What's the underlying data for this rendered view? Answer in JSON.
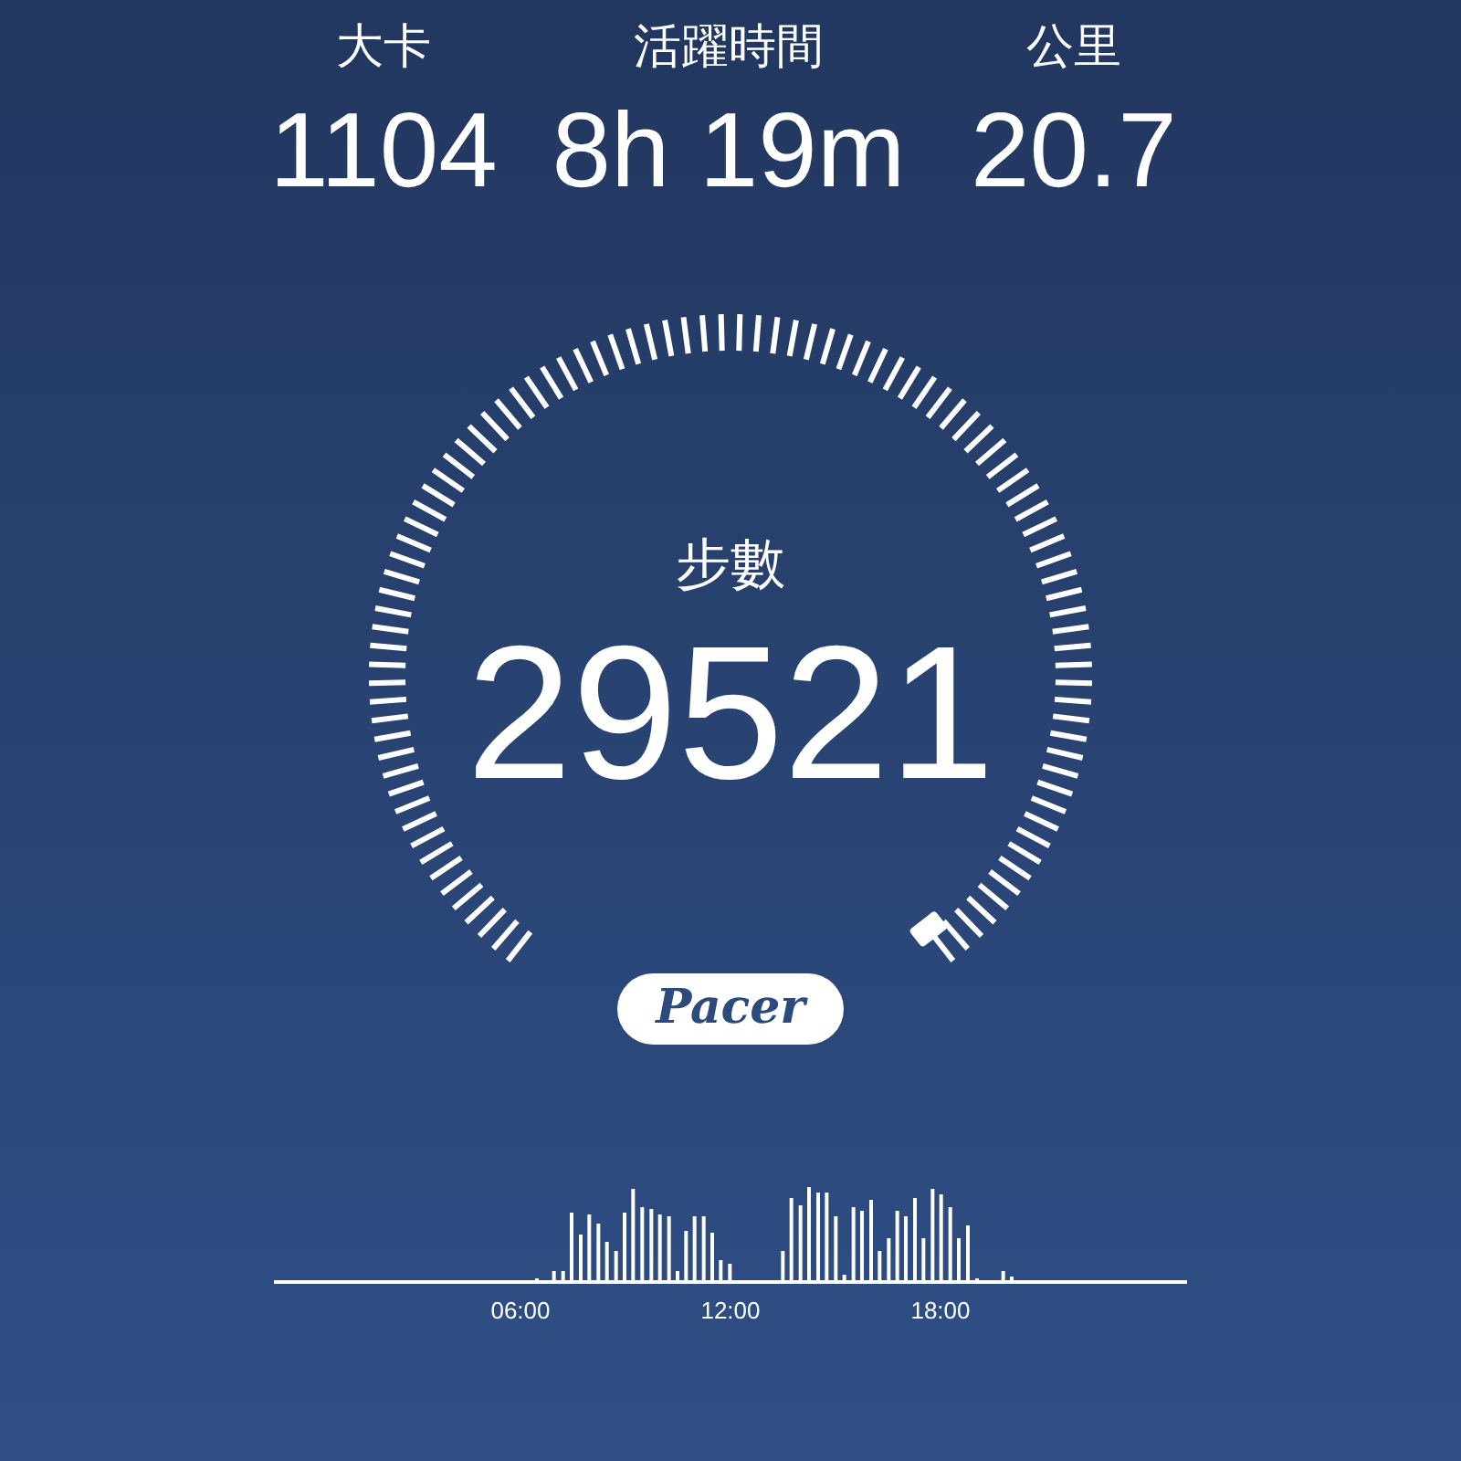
{
  "stats": [
    {
      "label": "大卡",
      "value": "1104"
    },
    {
      "label": "活躍時間",
      "value": "8h 19m"
    },
    {
      "label": "公里",
      "value": "20.7"
    }
  ],
  "gauge": {
    "label": "步數",
    "value": "29521"
  },
  "logo": "Pacer",
  "chart": {
    "time_labels": [
      "06:00",
      "12:00",
      "18:00"
    ]
  }
}
